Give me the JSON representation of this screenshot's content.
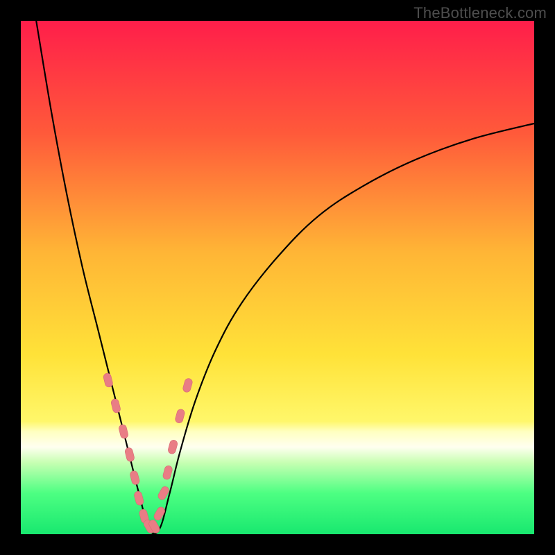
{
  "watermark": "TheBottleneck.com",
  "colors": {
    "frame": "#000000",
    "gradient_stops": [
      {
        "pct": 0,
        "color": "#ff1e4a"
      },
      {
        "pct": 22,
        "color": "#ff5a3a"
      },
      {
        "pct": 45,
        "color": "#ffb536"
      },
      {
        "pct": 65,
        "color": "#ffe238"
      },
      {
        "pct": 78,
        "color": "#fff76a"
      },
      {
        "pct": 80,
        "color": "#ffffc0"
      },
      {
        "pct": 83,
        "color": "#fffff0"
      },
      {
        "pct": 86,
        "color": "#c8ffb3"
      },
      {
        "pct": 92,
        "color": "#4dff82"
      },
      {
        "pct": 100,
        "color": "#18e86f"
      }
    ],
    "curve": "#000000",
    "marker_fill": "#e97d85",
    "marker_stroke": "#d86b73"
  },
  "chart_data": {
    "type": "line",
    "title": "",
    "xlabel": "",
    "ylabel": "",
    "xlim": [
      0,
      100
    ],
    "ylim": [
      0,
      100
    ],
    "note": "V-shaped bottleneck curve; minimum (0%) near x≈25; left branch rises to 100% at x≈3; right branch rises asymptotically toward ~80% at x=100. y values are percentage-of-plot-height from bottom.",
    "series": [
      {
        "name": "bottleneck-curve",
        "x": [
          3,
          6,
          9,
          12,
          15,
          17,
          19,
          21,
          23,
          25,
          27,
          29,
          31,
          34,
          38,
          43,
          50,
          58,
          67,
          77,
          88,
          100
        ],
        "y": [
          100,
          82,
          66,
          52,
          40,
          32,
          24,
          16,
          8,
          1,
          1,
          8,
          16,
          26,
          36,
          45,
          54,
          62,
          68,
          73,
          77,
          80
        ]
      }
    ],
    "markers": {
      "name": "highlighted-points",
      "note": "Capsule/lozenge markers clustered along both branches near the trough, in the yellow-to-green band (~y 3–30%).",
      "x": [
        17,
        18.5,
        20,
        21.2,
        22.2,
        23,
        24,
        25,
        26,
        27,
        27.8,
        28.6,
        29.6,
        31,
        32.5
      ],
      "y": [
        30,
        25,
        20,
        15.5,
        11,
        7,
        3.5,
        1.5,
        1.5,
        4,
        8,
        12,
        17,
        23,
        29
      ]
    }
  }
}
